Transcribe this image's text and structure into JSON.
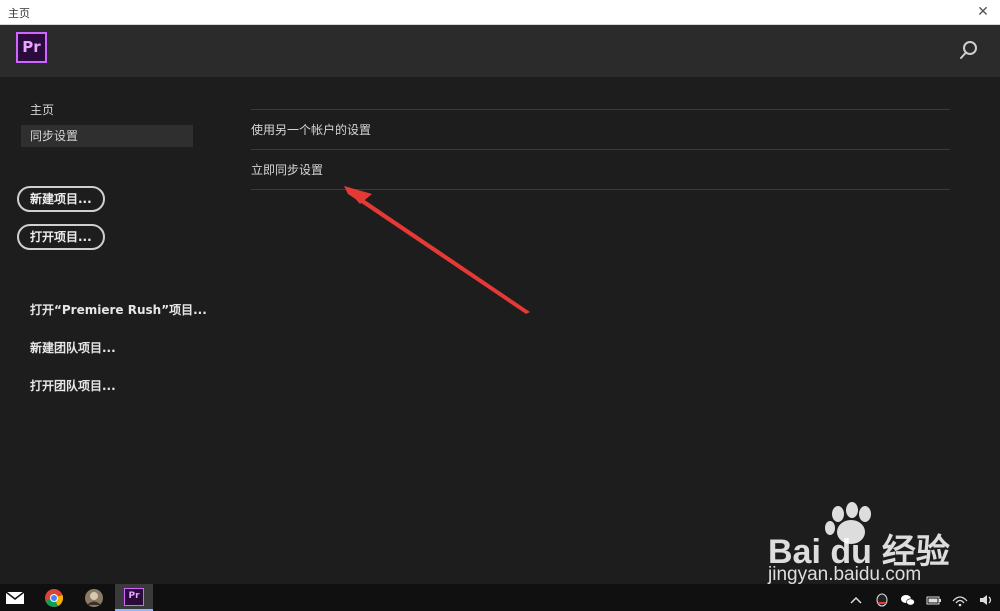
{
  "window": {
    "title": "主页",
    "close_glyph": "✕"
  },
  "header": {
    "logo_text": "Pr",
    "search_icon": "search-icon"
  },
  "sidebar": {
    "nav": [
      {
        "label": "主页"
      },
      {
        "label": "同步设置",
        "active": true
      }
    ],
    "buttons": [
      {
        "label": "新建项目..."
      },
      {
        "label": "打开项目..."
      }
    ],
    "links": [
      {
        "label": "打开“Premiere Rush”项目..."
      },
      {
        "label": "新建团队项目..."
      },
      {
        "label": "打开团队项目..."
      }
    ]
  },
  "main": {
    "rows": [
      {
        "label": "使用另一个帐户的设置"
      },
      {
        "label": "立即同步设置"
      }
    ]
  },
  "annotation": {
    "arrow_color": "#e53935"
  },
  "watermark": {
    "brand": "Bai du",
    "suffix": "经验",
    "url": "jingyan.baidu.com"
  },
  "taskbar": {
    "apps": [
      "mail-icon",
      "chrome-icon",
      "avatar-app-icon",
      "premiere-icon"
    ],
    "premiere_label": "Pr"
  },
  "colors": {
    "accent_purple": "#d066ff",
    "background": "#1d1d1d"
  }
}
